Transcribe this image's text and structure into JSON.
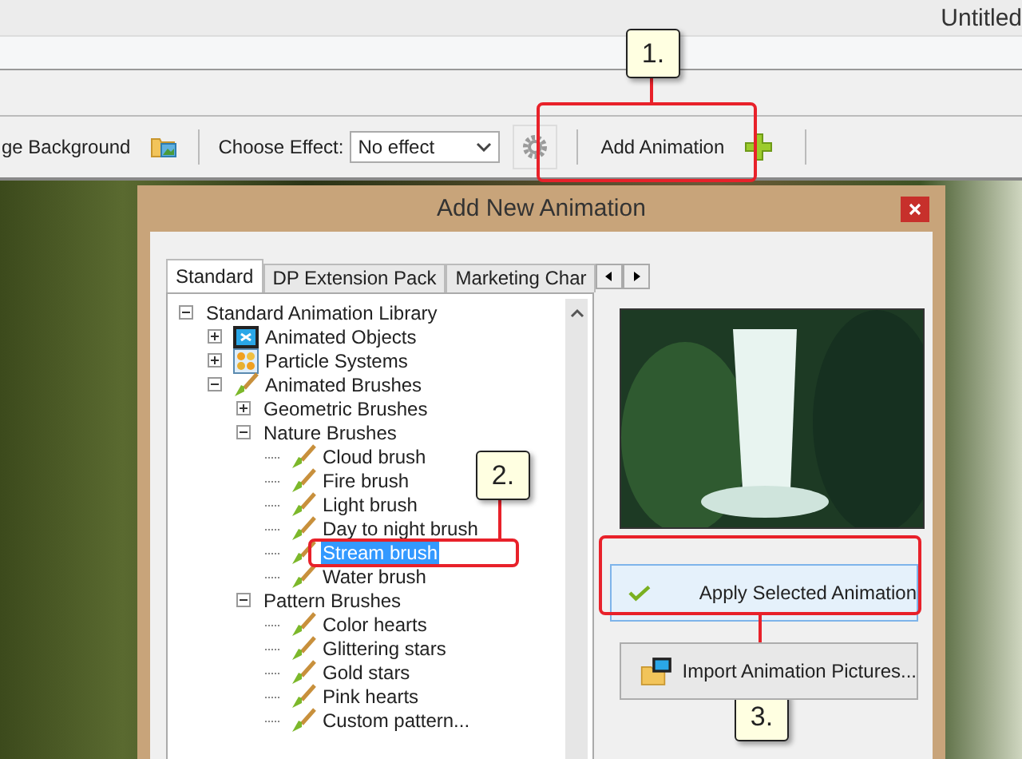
{
  "window": {
    "title": "Untitled"
  },
  "toolbar": {
    "background_label": "ge Background",
    "effect_label": "Choose Effect:",
    "effect_value": "No effect",
    "add_button": "Add Animation"
  },
  "dialog": {
    "title": "Add New Animation",
    "tabs": [
      {
        "label": "Standard",
        "selected": true
      },
      {
        "label": "DP Extension Pack",
        "selected": false
      },
      {
        "label": "Marketing Char",
        "selected": false
      }
    ],
    "tree": [
      {
        "label": "Standard Animation Library",
        "expanded": true,
        "selected": false,
        "children": [
          {
            "label": "Animated Objects",
            "kind": "film",
            "expanded": false,
            "selected": false
          },
          {
            "label": "Particle Systems",
            "kind": "particles",
            "expanded": false,
            "selected": false
          },
          {
            "label": "Animated Brushes",
            "kind": "brush",
            "expanded": true,
            "selected": false,
            "children": [
              {
                "label": "Geometric Brushes",
                "expanded": false,
                "selected": false
              },
              {
                "label": "Nature Brushes",
                "expanded": true,
                "selected": false,
                "children": [
                  {
                    "label": "Cloud brush",
                    "kind": "brush",
                    "selected": false
                  },
                  {
                    "label": "Fire brush",
                    "kind": "brush",
                    "selected": false
                  },
                  {
                    "label": "Light brush",
                    "kind": "brush",
                    "selected": false
                  },
                  {
                    "label": "Day to night brush",
                    "kind": "brush",
                    "selected": false
                  },
                  {
                    "label": "Stream brush",
                    "kind": "brush",
                    "selected": true
                  },
                  {
                    "label": "Water brush",
                    "kind": "brush",
                    "selected": false
                  }
                ]
              },
              {
                "label": "Pattern Brushes",
                "expanded": true,
                "selected": false,
                "children": [
                  {
                    "label": "Color hearts",
                    "kind": "brush",
                    "selected": false
                  },
                  {
                    "label": "Glittering stars",
                    "kind": "brush",
                    "selected": false
                  },
                  {
                    "label": "Gold stars",
                    "kind": "brush",
                    "selected": false
                  },
                  {
                    "label": "Pink hearts",
                    "kind": "brush",
                    "selected": false
                  },
                  {
                    "label": "Custom pattern...",
                    "kind": "brush",
                    "selected": false
                  }
                ]
              }
            ]
          }
        ]
      }
    ],
    "apply_button": "Apply Selected Animation",
    "import_button": "Import Animation Pictures..."
  },
  "callouts": [
    {
      "label": "1."
    },
    {
      "label": "2."
    },
    {
      "label": "3."
    }
  ]
}
